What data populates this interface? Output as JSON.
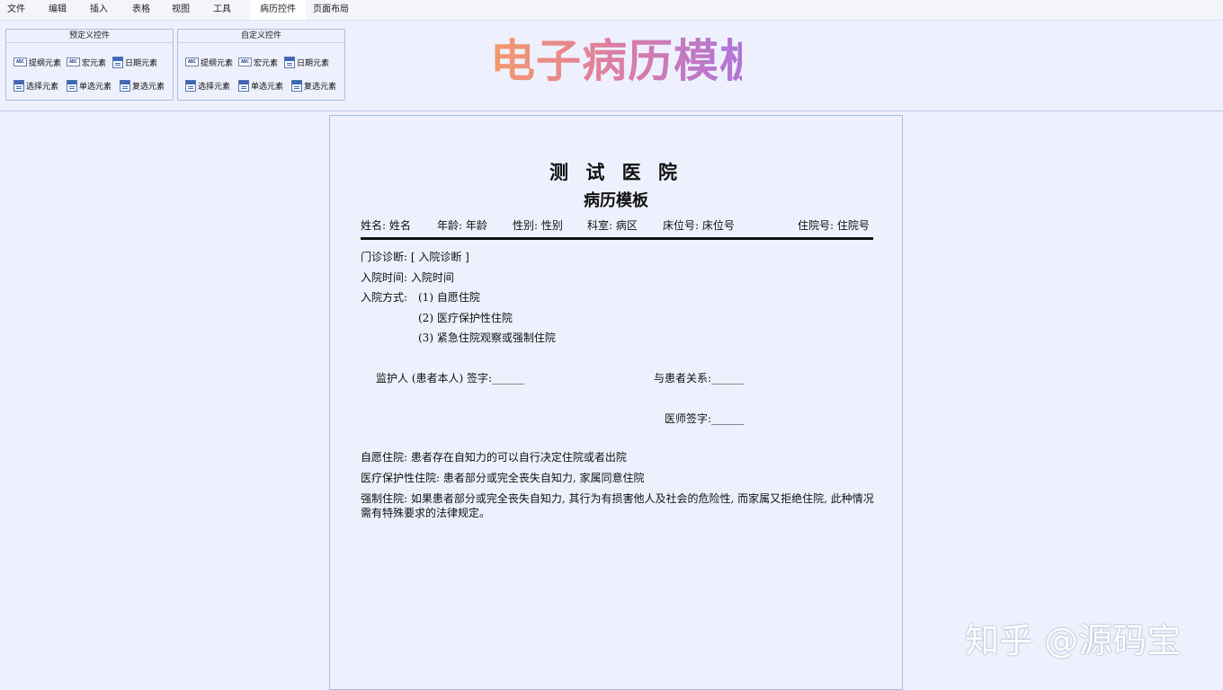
{
  "menu": {
    "items": [
      "文件",
      "编辑",
      "插入",
      "表格",
      "视图",
      "工具",
      "病历控件",
      "页面布局"
    ],
    "active": "病历控件"
  },
  "ribbon": {
    "groups": [
      {
        "title": "预定义控件",
        "controls": [
          {
            "label": "提纲元素",
            "icon": "abc-field-icon"
          },
          {
            "label": "宏元素",
            "icon": "abc-field-icon"
          },
          {
            "label": "日期元素",
            "icon": "date-field-icon"
          },
          {
            "label": "选择元素",
            "icon": "select-field-icon"
          },
          {
            "label": "单选元素",
            "icon": "radio-field-icon"
          },
          {
            "label": "复选元素",
            "icon": "checkbox-field-icon"
          }
        ]
      },
      {
        "title": "自定义控件",
        "controls": [
          {
            "label": "提纲元素",
            "icon": "abc-field-icon"
          },
          {
            "label": "宏元素",
            "icon": "abc-field-icon"
          },
          {
            "label": "日期元素",
            "icon": "date-field-icon"
          },
          {
            "label": "选择元素",
            "icon": "select-field-icon"
          },
          {
            "label": "单选元素",
            "icon": "radio-field-icon"
          },
          {
            "label": "复选元素",
            "icon": "checkbox-field-icon"
          }
        ]
      }
    ],
    "abc_icon_text": "ABC"
  },
  "banner": "电子病历模板",
  "document": {
    "title": "测 试 医 院",
    "subtitle": "病历模板",
    "info": {
      "name": "姓名: 姓名",
      "age": "年龄: 年龄",
      "gender": "性别: 性别",
      "dept": "科室: 病区",
      "bed": "床位号: 床位号",
      "admission_no": "住院号: 住院号"
    },
    "outpatient_diagnosis": "门诊诊断: [ 入院诊断 ]",
    "admission_time": "入院时间:  入院时间",
    "admission_mode_label": "入院方式:",
    "admission_options": [
      "(1) 自愿住院",
      "(2) 医疗保护性住院",
      "(3) 紧急住院观察或强制住院"
    ],
    "guardian_signature": "监护人 (患者本人) 签字:______",
    "relationship": "与患者关系:______",
    "doctor_signature": "医师签字:______",
    "notes": [
      "自愿住院: 患者存在自知力的可以自行决定住院或者出院",
      "医疗保护性住院: 患者部分或完全丧失自知力, 家属同意住院",
      "强制住院: 如果患者部分或完全丧失自知力, 其行为有损害他人及社会的危险性, 而家属又拒绝住院, 此种情况需有特殊要求的法律规定。"
    ]
  },
  "watermark": "知乎 @源码宝"
}
